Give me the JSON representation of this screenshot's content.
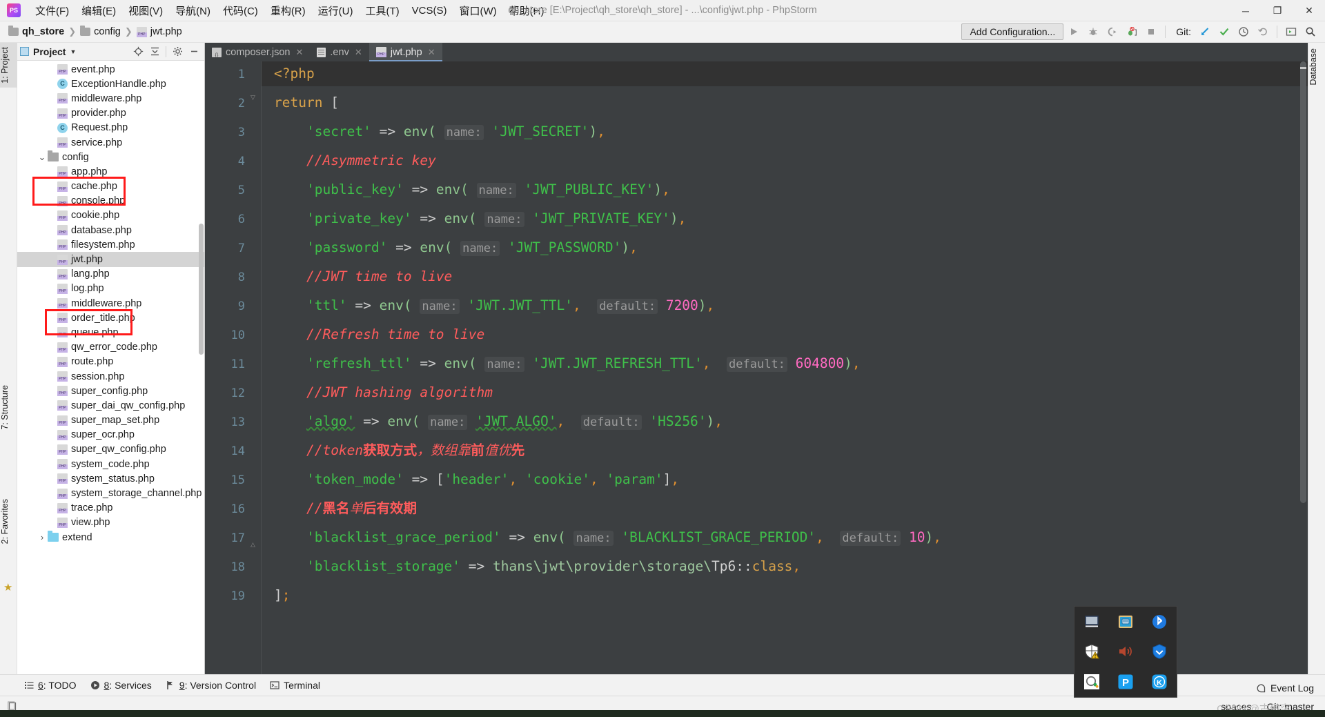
{
  "window": {
    "title": "qh_store [E:\\Project\\qh_store\\qh_store] - ...\\config\\jwt.php - PhpStorm",
    "minimize": "─",
    "maximize": "❐",
    "close": "✕",
    "logo": "ps-logo"
  },
  "menu": [
    "文件(F)",
    "编辑(E)",
    "视图(V)",
    "导航(N)",
    "代码(C)",
    "重构(R)",
    "运行(U)",
    "工具(T)",
    "VCS(S)",
    "窗口(W)",
    "帮助(H)"
  ],
  "breadcrumb": [
    {
      "icon": "folder-icon",
      "label": "qh_store"
    },
    {
      "icon": "folder-icon",
      "label": "config"
    },
    {
      "icon": "php-file-icon",
      "label": "jwt.php"
    }
  ],
  "toolbar": {
    "add_configuration": "Add Configuration...",
    "run_icon": "run-icon",
    "debug_icon": "debug-icon",
    "coverage_icon": "coverage-icon",
    "profile_icon": "profile-icon",
    "stop_icon": "stop-icon",
    "git_label": "Git:",
    "git_update_icon": "git-update-icon",
    "git_commit_icon": "git-commit-icon",
    "git_history_icon": "git-history-icon",
    "git_rollback_icon": "git-rollback-icon",
    "terminal_icon": "terminal-icon",
    "search_icon": "search-icon"
  },
  "left_strips": [
    {
      "label": "1: Project",
      "selected": true
    },
    {
      "label": "7: Structure",
      "selected": false
    },
    {
      "label": "2: Favorites",
      "selected": false
    },
    {
      "label": "star-icon",
      "selected": false
    }
  ],
  "right_strips": [
    {
      "label": "Database",
      "selected": false
    }
  ],
  "project_panel": {
    "title": "Project",
    "select_target_icon": "locate-icon",
    "collapse_all_icon": "collapse-all-icon",
    "settings_icon": "gear-icon",
    "hide_icon": "hide-icon",
    "items": [
      {
        "name": "event.php",
        "icon": "php-file-icon",
        "indent": 3,
        "selected": false
      },
      {
        "name": "ExceptionHandle.php",
        "icon": "class-icon",
        "indent": 3,
        "selected": false
      },
      {
        "name": "middleware.php",
        "icon": "php-file-icon",
        "indent": 3,
        "selected": false
      },
      {
        "name": "provider.php",
        "icon": "php-file-icon",
        "indent": 3,
        "selected": false
      },
      {
        "name": "Request.php",
        "icon": "class-icon",
        "indent": 3,
        "selected": false
      },
      {
        "name": "service.php",
        "icon": "php-file-icon",
        "indent": 3,
        "selected": false
      },
      {
        "name": "config",
        "icon": "folder-icon",
        "indent": 2,
        "selected": false,
        "expanded": true
      },
      {
        "name": "app.php",
        "icon": "php-file-icon",
        "indent": 3,
        "selected": false
      },
      {
        "name": "cache.php",
        "icon": "php-file-icon",
        "indent": 3,
        "selected": false
      },
      {
        "name": "console.php",
        "icon": "php-file-icon",
        "indent": 3,
        "selected": false
      },
      {
        "name": "cookie.php",
        "icon": "php-file-icon",
        "indent": 3,
        "selected": false
      },
      {
        "name": "database.php",
        "icon": "php-file-icon",
        "indent": 3,
        "selected": false
      },
      {
        "name": "filesystem.php",
        "icon": "php-file-icon",
        "indent": 3,
        "selected": false
      },
      {
        "name": "jwt.php",
        "icon": "php-file-icon",
        "indent": 3,
        "selected": true
      },
      {
        "name": "lang.php",
        "icon": "php-file-icon",
        "indent": 3,
        "selected": false
      },
      {
        "name": "log.php",
        "icon": "php-file-icon",
        "indent": 3,
        "selected": false
      },
      {
        "name": "middleware.php",
        "icon": "php-file-icon",
        "indent": 3,
        "selected": false
      },
      {
        "name": "order_title.php",
        "icon": "php-file-icon",
        "indent": 3,
        "selected": false
      },
      {
        "name": "queue.php",
        "icon": "php-file-icon",
        "indent": 3,
        "selected": false
      },
      {
        "name": "qw_error_code.php",
        "icon": "php-file-icon",
        "indent": 3,
        "selected": false
      },
      {
        "name": "route.php",
        "icon": "php-file-icon",
        "indent": 3,
        "selected": false
      },
      {
        "name": "session.php",
        "icon": "php-file-icon",
        "indent": 3,
        "selected": false
      },
      {
        "name": "super_config.php",
        "icon": "php-file-icon",
        "indent": 3,
        "selected": false
      },
      {
        "name": "super_dai_qw_config.php",
        "icon": "php-file-icon",
        "indent": 3,
        "selected": false
      },
      {
        "name": "super_map_set.php",
        "icon": "php-file-icon",
        "indent": 3,
        "selected": false
      },
      {
        "name": "super_ocr.php",
        "icon": "php-file-icon",
        "indent": 3,
        "selected": false
      },
      {
        "name": "super_qw_config.php",
        "icon": "php-file-icon",
        "indent": 3,
        "selected": false
      },
      {
        "name": "system_code.php",
        "icon": "php-file-icon",
        "indent": 3,
        "selected": false
      },
      {
        "name": "system_status.php",
        "icon": "php-file-icon",
        "indent": 3,
        "selected": false
      },
      {
        "name": "system_storage_channel.php",
        "icon": "php-file-icon",
        "indent": 3,
        "selected": false
      },
      {
        "name": "trace.php",
        "icon": "php-file-icon",
        "indent": 3,
        "selected": false
      },
      {
        "name": "view.php",
        "icon": "php-file-icon",
        "indent": 3,
        "selected": false
      },
      {
        "name": "extend",
        "icon": "folder-blue-icon",
        "indent": 2,
        "selected": false,
        "expanded": false
      }
    ]
  },
  "editor": {
    "tabs": [
      {
        "label": "composer.json",
        "icon": "json-file-icon",
        "active": false,
        "close": "✕"
      },
      {
        "label": ".env",
        "icon": "env-file-icon",
        "active": false,
        "close": "✕"
      },
      {
        "label": "jwt.php",
        "icon": "php-file-icon",
        "active": true,
        "close": "✕"
      }
    ],
    "current_line": 1,
    "line_numbers": [
      1,
      2,
      3,
      4,
      5,
      6,
      7,
      8,
      9,
      10,
      11,
      12,
      13,
      14,
      15,
      16,
      17,
      18,
      19
    ],
    "code_lines": [
      {
        "n": 1,
        "text": "<?php"
      },
      {
        "n": 2,
        "text": "return ["
      },
      {
        "n": 3,
        "text": "    'secret' => env( name: 'JWT_SECRET'),"
      },
      {
        "n": 4,
        "text": "    //Asymmetric key"
      },
      {
        "n": 5,
        "text": "    'public_key' => env( name: 'JWT_PUBLIC_KEY'),"
      },
      {
        "n": 6,
        "text": "    'private_key' => env( name: 'JWT_PRIVATE_KEY'),"
      },
      {
        "n": 7,
        "text": "    'password' => env( name: 'JWT_PASSWORD'),"
      },
      {
        "n": 8,
        "text": "    //JWT time to live"
      },
      {
        "n": 9,
        "text": "    'ttl' => env( name: 'JWT.JWT_TTL',  default: 7200),"
      },
      {
        "n": 10,
        "text": "    //Refresh time to live"
      },
      {
        "n": 11,
        "text": "    'refresh_ttl' => env( name: 'JWT.JWT_REFRESH_TTL',  default: 604800),"
      },
      {
        "n": 12,
        "text": "    //JWT hashing algorithm"
      },
      {
        "n": 13,
        "text": "    'algo' => env( name: 'JWT_ALGO',  default: 'HS256'),"
      },
      {
        "n": 14,
        "text": "    //token获取方式，数组靠前值优先"
      },
      {
        "n": 15,
        "text": "    'token_mode' => ['header', 'cookie', 'param'],"
      },
      {
        "n": 16,
        "text": "    //黑名单后有效期"
      },
      {
        "n": 17,
        "text": "    'blacklist_grace_period' => env( name: 'BLACKLIST_GRACE_PERIOD',  default: 10),"
      },
      {
        "n": 18,
        "text": "    'blacklist_storage' => thans\\jwt\\provider\\storage\\Tp6::class,"
      },
      {
        "n": 19,
        "text": "];"
      }
    ]
  },
  "tray": {
    "icons": [
      "display-icon",
      "network-icon",
      "bluetooth-icon",
      "security-shield-warning-icon",
      "volume-icon",
      "tencent-shield-icon",
      "qq-icon",
      "pinyin-p-icon",
      "kingsoft-k-icon"
    ]
  },
  "bottom_bar": [
    {
      "icon": "todo-icon",
      "num": "6",
      "label": ": TODO"
    },
    {
      "icon": "services-icon",
      "num": "8",
      "label": ": Services"
    },
    {
      "icon": "version-control-icon",
      "num": "9",
      "label": ": Version Control"
    },
    {
      "icon": "terminal-icon",
      "num": "",
      "label": "Terminal"
    }
  ],
  "status_bar": {
    "left_icon": "document-icon",
    "spaces": "spaces",
    "git_branch": "Git: master",
    "event_log": "Event Log",
    "event_log_icon": "event-log-icon",
    "watermark": "CSDN @古傲突"
  },
  "colors": {
    "editor_bg": "#3c3f41",
    "string": "#3fc04a",
    "comment": "#ff5c5c",
    "keyword": "#d8a24a",
    "number": "#ff6ac1",
    "function": "#8fc88f",
    "annotation_red": "#ff1a1a",
    "selection": "#d4d4d4"
  }
}
